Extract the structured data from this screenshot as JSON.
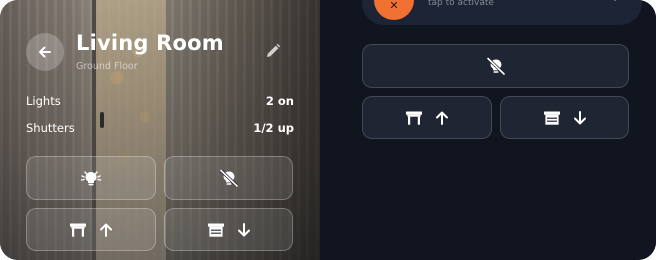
{
  "room": {
    "title": "Living Room",
    "floor": "Ground Floor",
    "stats": [
      {
        "label": "Lights",
        "value": "2 on"
      },
      {
        "label": "Shutters",
        "value": "1/2 up"
      }
    ]
  },
  "icons": {
    "back": "arrow-left-icon",
    "edit": "pencil-icon",
    "lights_on": "lightbulb-icon",
    "lights_off": "lightbulb-off-icon",
    "shutter_open": "shutter-open-icon",
    "shutter_close": "shutter-closed-icon",
    "arrow_up": "arrow-up-icon",
    "arrow_down": "arrow-down-icon"
  },
  "scene": {
    "hint": "tap to activate",
    "accent": "#f07131"
  },
  "colors": {
    "panel_bg": "#10151f",
    "button_bg": "#1f2532",
    "scene_pill": "#1c2436"
  }
}
